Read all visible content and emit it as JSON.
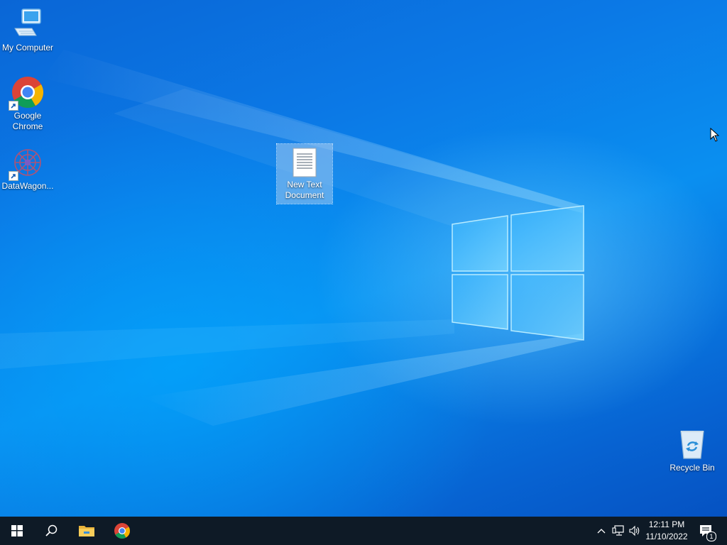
{
  "desktop": {
    "icons": [
      {
        "label": "My Computer",
        "icon": "computer-icon",
        "shortcut": false
      },
      {
        "label": "Google\nChrome",
        "icon": "chrome-icon",
        "shortcut": true
      },
      {
        "label": "DataWagon...",
        "icon": "datawagon-icon",
        "shortcut": true
      },
      {
        "label": "New Text\nDocument",
        "icon": "text-document-icon",
        "shortcut": false,
        "selected": true
      },
      {
        "label": "Recycle Bin",
        "icon": "recycle-bin-icon",
        "shortcut": false
      }
    ]
  },
  "taskbar": {
    "pinned": [
      {
        "icon": "start-windows-icon"
      },
      {
        "icon": "search-icon"
      },
      {
        "icon": "file-explorer-icon"
      },
      {
        "icon": "chrome-icon"
      }
    ],
    "tray": {
      "icons": [
        "chevron-up-icon",
        "network-icon",
        "volume-icon"
      ],
      "time": "12:11 PM",
      "date": "11/10/2022",
      "notifications_count": "1"
    }
  },
  "colors": {
    "taskbar": "#0e1a26",
    "wallpaper_blue": "#0a78e0",
    "selection": "#a0c8f0"
  }
}
